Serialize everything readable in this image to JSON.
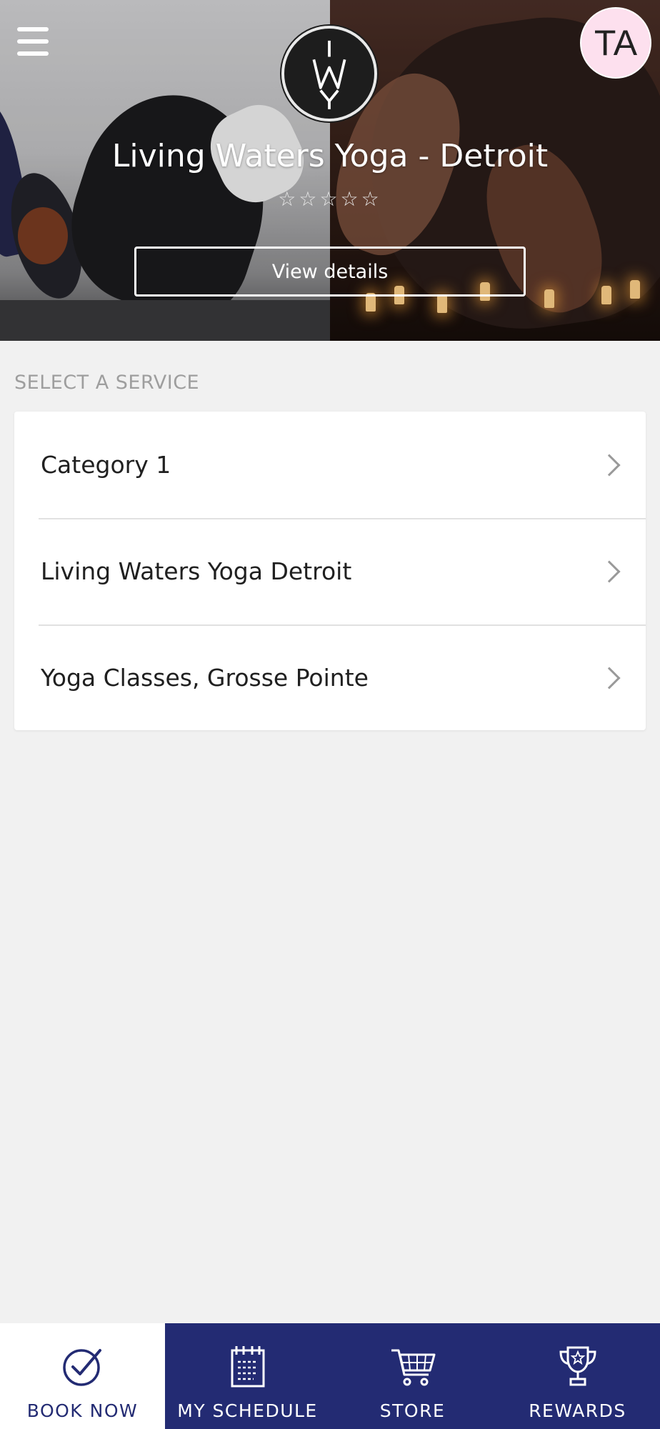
{
  "header": {
    "studio_name": "Living Waters Yoga - Detroit",
    "rating_stars": "☆☆☆☆☆",
    "view_details_label": "View details",
    "avatar_initials": "TA",
    "logo_letters": "IWY"
  },
  "services": {
    "section_title": "SELECT A SERVICE",
    "items": [
      {
        "label": "Category 1"
      },
      {
        "label": "Living Waters Yoga Detroit"
      },
      {
        "label": "Yoga Classes, Grosse Pointe"
      }
    ]
  },
  "bottom_nav": {
    "items": [
      {
        "label": "BOOK NOW",
        "icon": "check-circle-icon",
        "active": true
      },
      {
        "label": "MY SCHEDULE",
        "icon": "calendar-icon",
        "active": false
      },
      {
        "label": "STORE",
        "icon": "cart-icon",
        "active": false
      },
      {
        "label": "REWARDS",
        "icon": "trophy-icon",
        "active": false
      }
    ]
  },
  "colors": {
    "nav_background": "#232b73",
    "avatar_background": "#fde0ee",
    "page_background": "#f1f1f1"
  }
}
